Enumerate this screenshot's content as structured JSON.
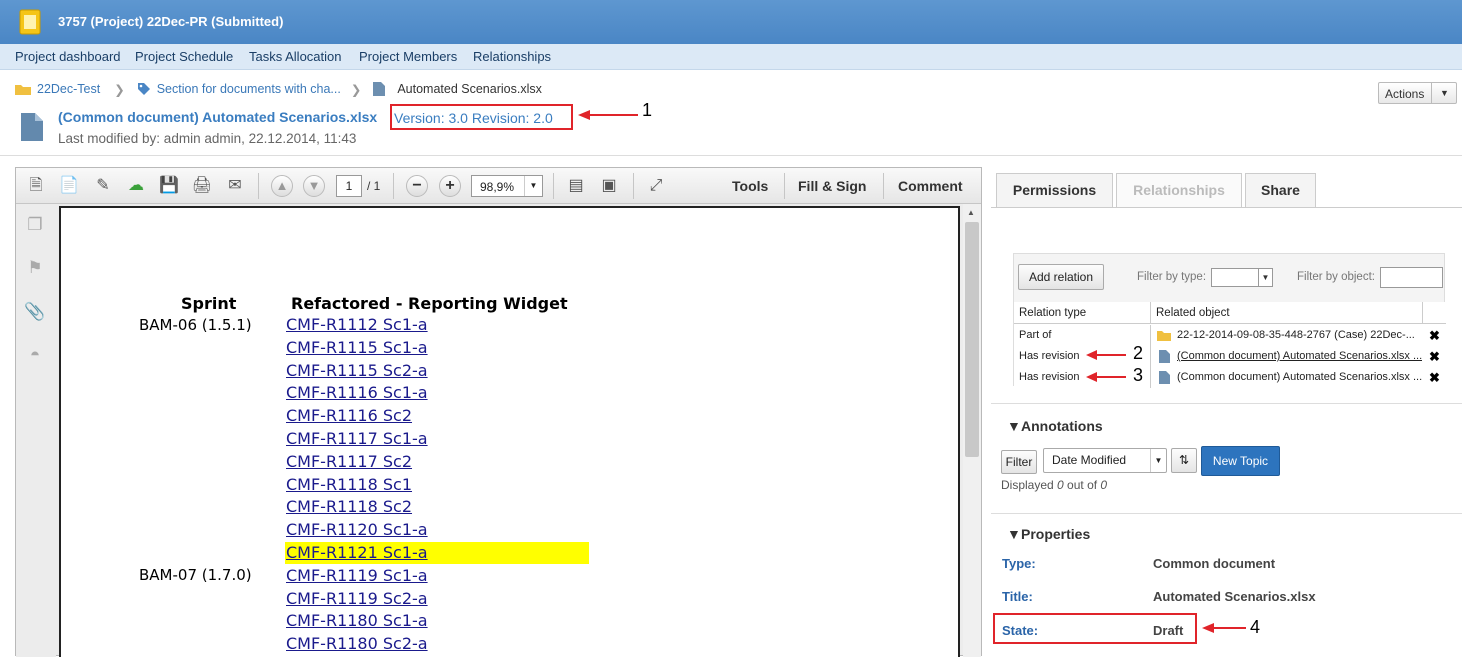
{
  "header": {
    "title": "3757 (Project) 22Dec-PR (Submitted)"
  },
  "nav": [
    "Project dashboard",
    "Project Schedule",
    "Tasks Allocation",
    "Project Members",
    "Relationships"
  ],
  "breadcrumb": {
    "item1": "22Dec-Test",
    "item2": "Section for documents with cha...",
    "current": "Automated Scenarios.xlsx"
  },
  "actions_label": "Actions",
  "document": {
    "name": "(Common document) Automated Scenarios.xlsx",
    "version": "Version: 3.0 Revision: 2.0",
    "last_modified": "Last modified by: admin admin, 22.12.2014, 11:43"
  },
  "viewer": {
    "page_current": "1",
    "page_total": "/ 1",
    "zoom": "98,9%",
    "tools_label": "Tools",
    "fill_sign_label": "Fill & Sign",
    "comment_label": "Comment",
    "doc_headers": {
      "sprint": "Sprint",
      "refactored": "Refactored - Reporting Widget"
    },
    "sprints": [
      "BAM-06 (1.5.1)",
      "BAM-07 (1.7.0)"
    ],
    "links": [
      "CMF-R1112 Sc1-a",
      "CMF-R1115 Sc1-a",
      "CMF-R1115 Sc2-a",
      "CMF-R1116 Sc1-a",
      "CMF-R1116 Sc2",
      "CMF-R1117 Sc1-a",
      "CMF-R1117 Sc2",
      "CMF-R1118 Sc1",
      "CMF-R1118 Sc2",
      "CMF-R1120 Sc1-a",
      "CMF-R1121 Sc1-a",
      "CMF-R1119 Sc1-a",
      "CMF-R1119 Sc2-a",
      "CMF-R1180 Sc1-a",
      "CMF-R1180 Sc2-a"
    ],
    "highlight_color": "#ffff00"
  },
  "tabs": [
    "Permissions",
    "Relationships",
    "Share"
  ],
  "relations": {
    "add_label": "Add relation",
    "filter_type_label": "Filter by type:",
    "filter_object_label": "Filter by object:",
    "columns": [
      "Relation type",
      "Related object"
    ],
    "rows": [
      {
        "type": "Part of",
        "object": "22-12-2014-09-08-35-448-2767 (Case) 22Dec-..."
      },
      {
        "type": "Has revision",
        "object": "(Common document) Automated Scenarios.xlsx ..."
      },
      {
        "type": "Has revision",
        "object": "(Common document) Automated Scenarios.xlsx ..."
      }
    ]
  },
  "annotations": {
    "title": "Annotations",
    "filter_label": "Filter",
    "sort_value": "Date Modified",
    "new_topic_label": "New Topic",
    "displayed_prefix": "Displayed ",
    "displayed_count": "0",
    "displayed_mid": " out of ",
    "displayed_total": "0"
  },
  "properties": {
    "title": "Properties",
    "type_label": "Type:",
    "type_value": "Common document",
    "title_label": "Title:",
    "title_value": "Automated Scenarios.xlsx",
    "state_label": "State:",
    "state_value": "Draft"
  },
  "callouts": [
    "1",
    "2",
    "3",
    "4"
  ],
  "colors": {
    "accent": "#3a7dc0",
    "callout_red": "#e0242a",
    "new_topic": "#2d74be"
  }
}
